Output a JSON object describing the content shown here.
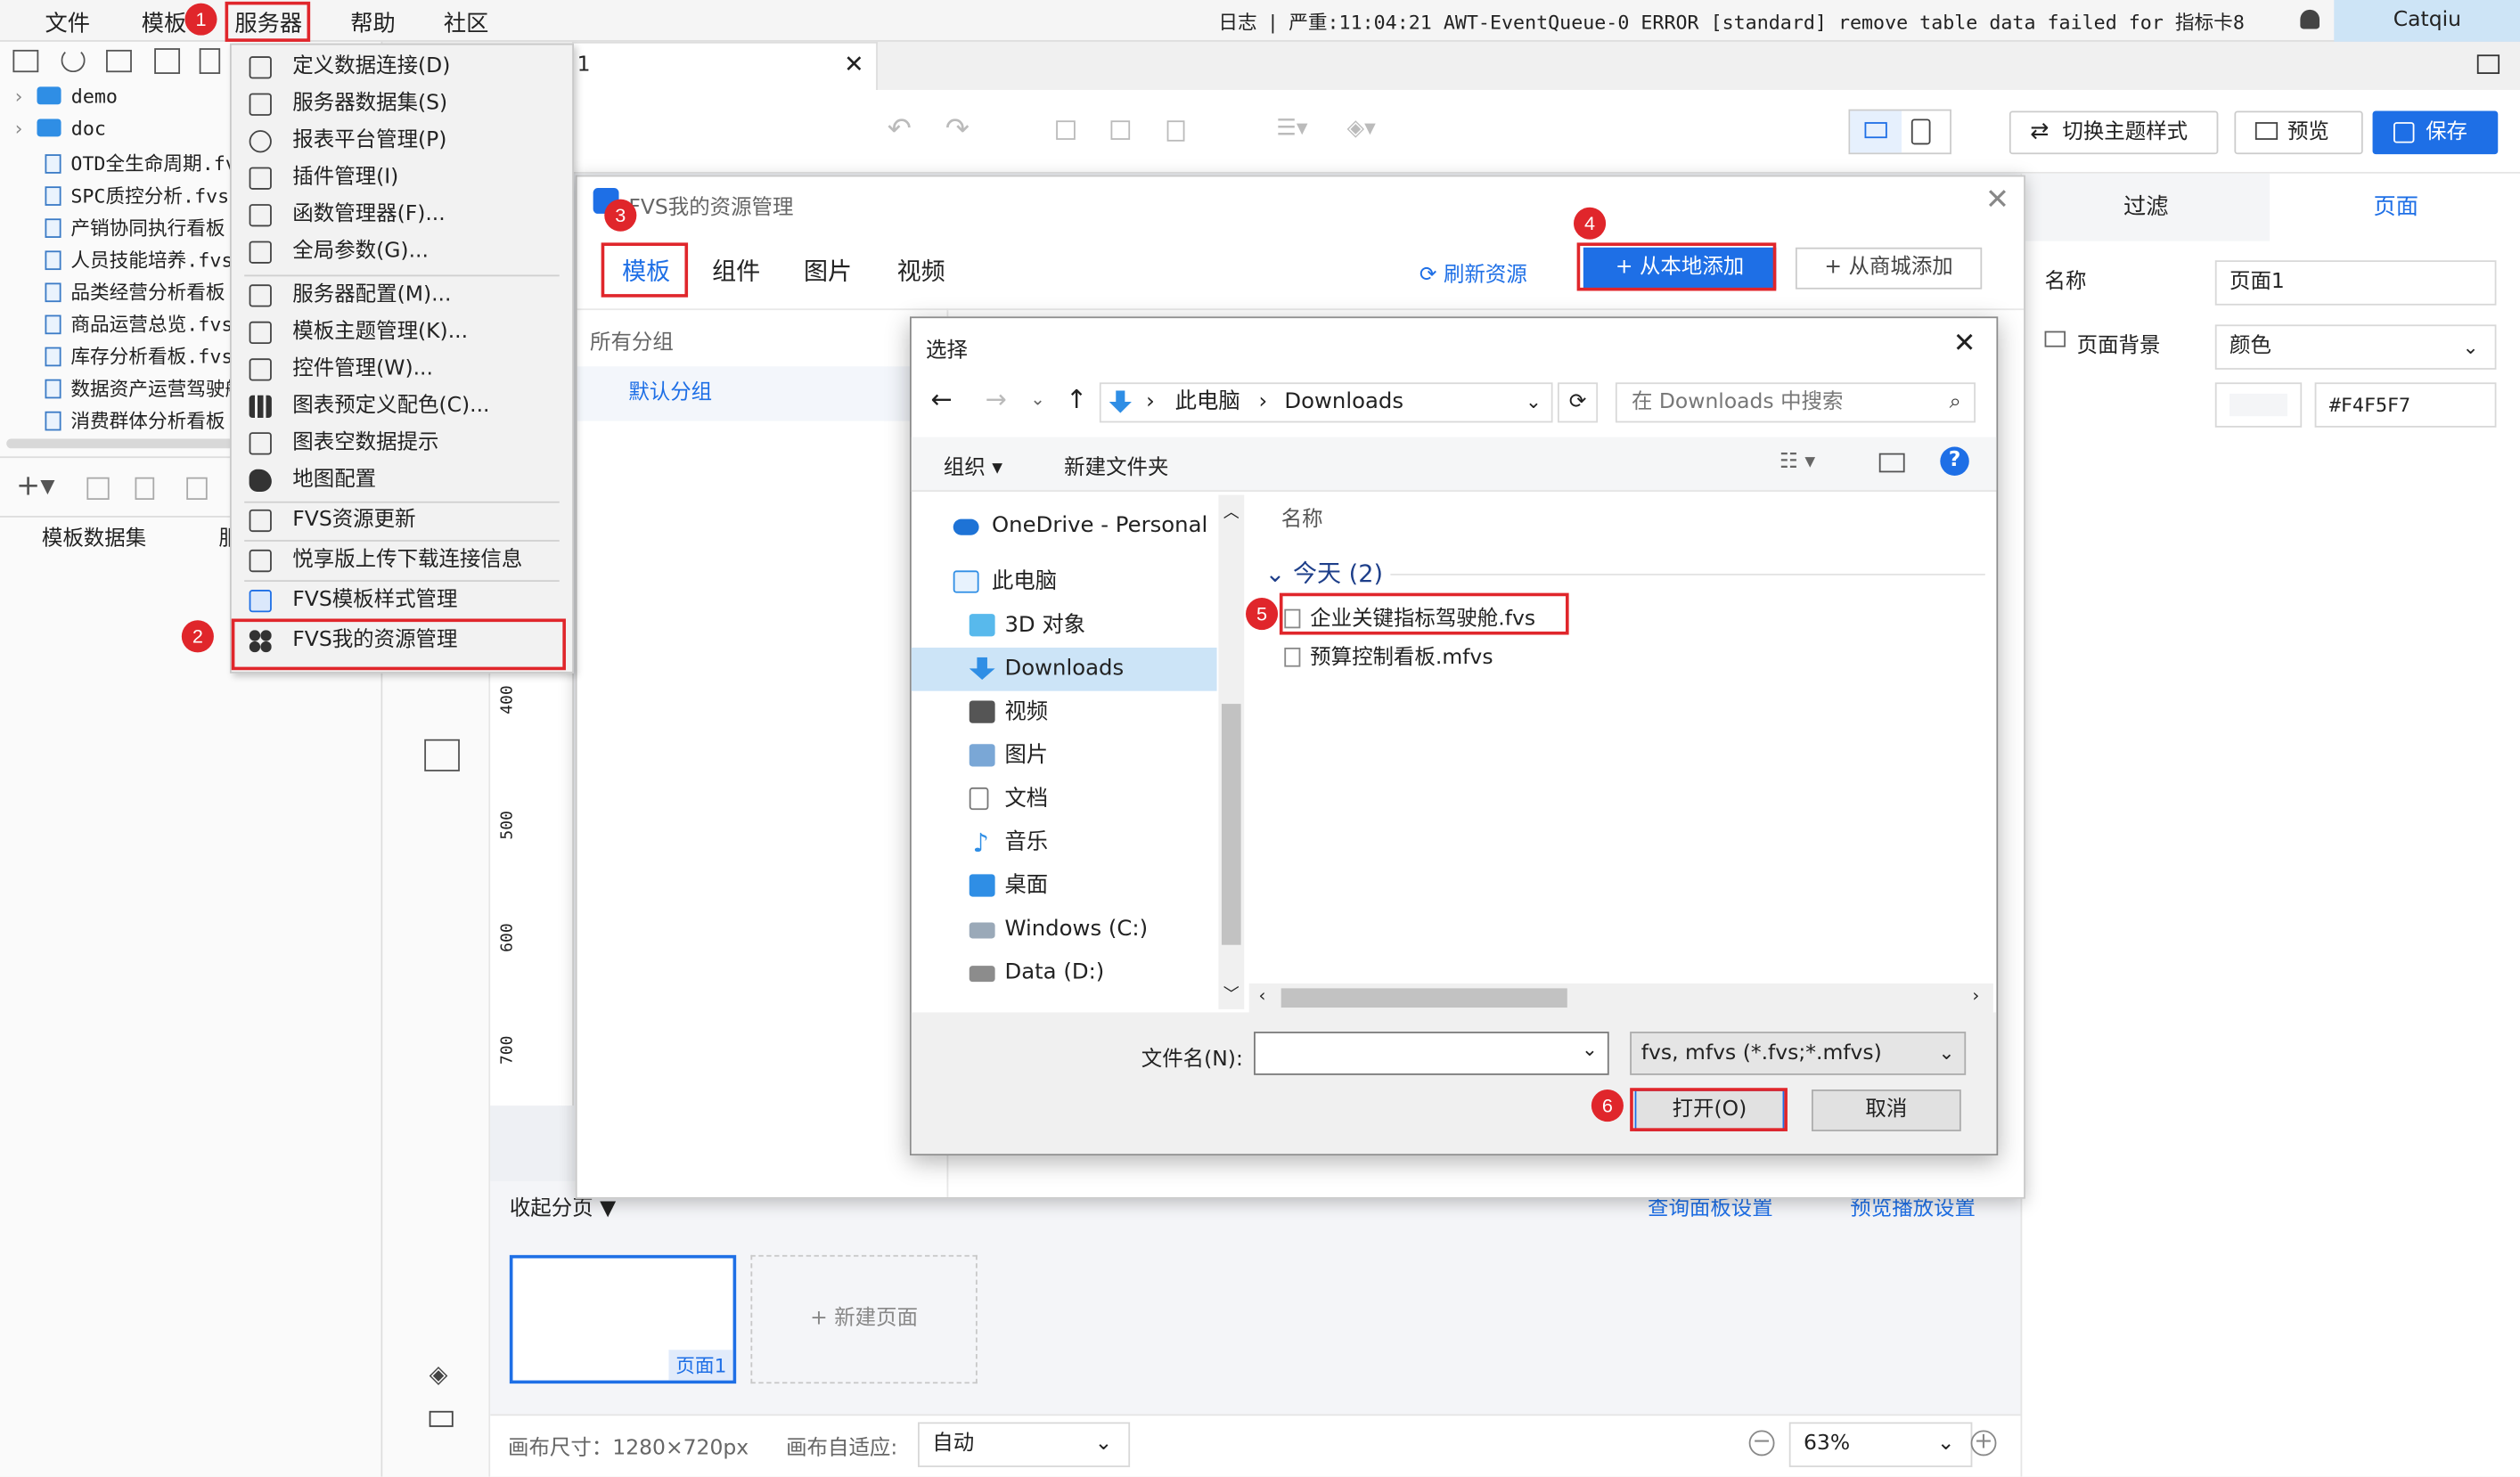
{
  "menubar": {
    "items": [
      "文件",
      "模板",
      "服务器",
      "帮助",
      "社区"
    ],
    "log_label": "日志",
    "log_message": "严重:11:04:21 AWT-EventQueue-0 ERROR [standard] remove table data failed for 指标卡8",
    "user": "Catqiu"
  },
  "tree": {
    "folders": [
      "demo",
      "doc"
    ],
    "files": [
      "OTD全生命周期.fvs",
      "SPC质控分析.fvs",
      "产销协同执行看板",
      "人员技能培养.fvs",
      "品类经营分析看板",
      "商品运营总览.fvs",
      "库存分析看板.fvs",
      "数据资产运营驾驶舱",
      "消费群体分析看板"
    ]
  },
  "left_bottom": {
    "tab1": "模板数据集",
    "tab2": "服"
  },
  "server_menu": {
    "items": [
      "定义数据连接(D)",
      "服务器数据集(S)",
      "报表平台管理(P)",
      "插件管理(I)",
      "函数管理器(F)...",
      "全局参数(G)...",
      "服务器配置(M)...",
      "模板主题管理(K)...",
      "控件管理(W)...",
      "图表预定义配色(C)...",
      "图表空数据提示",
      "地图配置",
      "FVS资源更新",
      "悦享版上传下载连接信息",
      "FVS模板样式管理",
      "FVS我的资源管理"
    ]
  },
  "editor_tab": {
    "label": "1"
  },
  "toolbar": {
    "switch_theme": "切换主题样式",
    "preview": "预览",
    "save": "保存"
  },
  "right_panel": {
    "tabs": [
      "过滤",
      "页面"
    ],
    "name_label": "名称",
    "name_value": "页面1",
    "bg_label": "页面背景",
    "bg_type": "颜色",
    "bg_color": "#F4F5F7"
  },
  "resource_dialog": {
    "title": "FVS我的资源管理",
    "tabs": [
      "模板",
      "组件",
      "图片",
      "视频"
    ],
    "refresh": "刷新资源",
    "add_local": "从本地添加",
    "add_store": "从商城添加",
    "all_groups": "所有分组",
    "default_group": "默认分组"
  },
  "file_dialog": {
    "title": "选择",
    "breadcrumb": [
      "此电脑",
      "Downloads"
    ],
    "search_placeholder": "在 Downloads 中搜索",
    "organize": "组织",
    "new_folder": "新建文件夹",
    "nav": [
      "OneDrive - Personal",
      "此电脑",
      "3D 对象",
      "Downloads",
      "视频",
      "图片",
      "文档",
      "音乐",
      "桌面",
      "Windows (C:)",
      "Data (D:)"
    ],
    "column_name": "名称",
    "group_header": "今天 (2)",
    "files": [
      "企业关键指标驾驶舱.fvs",
      "预算控制看板.mfvs"
    ],
    "filename_label": "文件名(N):",
    "filename_value": "",
    "filter": "fvs, mfvs (*.fvs;*.mfvs)",
    "open": "打开(O)",
    "cancel": "取消"
  },
  "pages": {
    "collapse": "收起分页",
    "query_settings": "查询面板设置",
    "carousel_settings": "预览播放设置",
    "page1": "页面1",
    "new_page": "新建页面"
  },
  "status": {
    "canvas_size": "画布尺寸：1280×720px",
    "adapt_label": "画布自适应:",
    "adapt_value": "自动",
    "zoom": "63%"
  },
  "ruler": [
    "400",
    "500",
    "600",
    "700"
  ],
  "badges": [
    "1",
    "2",
    "3",
    "4",
    "5",
    "6"
  ],
  "colors": {
    "accent": "#1e6fe6",
    "annotation": "#e0262b",
    "selection": "#cce4f7"
  }
}
